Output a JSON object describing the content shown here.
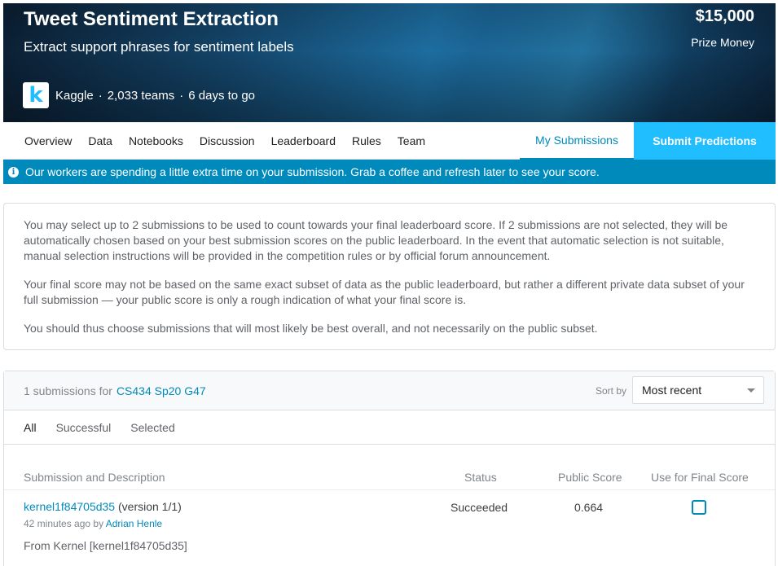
{
  "banner": {
    "title": "Tweet Sentiment Extraction",
    "subtitle": "Extract support phrases for sentiment labels",
    "prize_amount": "$15,000",
    "prize_label": "Prize Money",
    "logo_letter": "k",
    "host": "Kaggle",
    "teams": "2,033 teams",
    "deadline": "6 days to go",
    "separator": "·"
  },
  "nav": {
    "tabs": [
      "Overview",
      "Data",
      "Notebooks",
      "Discussion",
      "Leaderboard",
      "Rules",
      "Team"
    ],
    "my_submissions": "My Submissions",
    "submit": "Submit Predictions"
  },
  "infobar": {
    "icon": "info-icon",
    "message": "Our workers are spending a little extra time on your submission. Grab a coffee and refresh later to see your score."
  },
  "notice": {
    "p1": "You may select up to 2 submissions to be used to count towards your final leaderboard score. If 2 submissions are not selected, they will be automatically chosen based on your best submission scores on the public leaderboard. In the event that automatic selection is not suitable, manual selection instructions will be provided in the competition rules or by official forum announcement.",
    "p2": "Your final score may not be based on the same exact subset of data as the public leaderboard, but rather a different private data subset of your full submission — your public score is only a rough indication of what your final score is.",
    "p3": "You should thus choose submissions that will most likely be best overall, and not necessarily on the public subset."
  },
  "submissions": {
    "count_text": "1 submissions for",
    "team": "CS434 Sp20 G47",
    "sort_label": "Sort by",
    "sort_value": "Most recent",
    "filters": [
      "All",
      "Successful",
      "Selected"
    ],
    "columns": {
      "description": "Submission and Description",
      "status": "Status",
      "public_score": "Public Score",
      "final": "Use for Final Score"
    },
    "rows": [
      {
        "name": "kernel1f84705d35",
        "version": "(version 1/1)",
        "time": "42 minutes ago by",
        "author": "Adrian Henle",
        "description": "From Kernel [kernel1f84705d35]",
        "status": "Succeeded",
        "score": "0.664",
        "selected": false
      }
    ]
  },
  "colors": {
    "accent": "#20beff",
    "link": "#008abc",
    "infobar": "#008abc"
  }
}
